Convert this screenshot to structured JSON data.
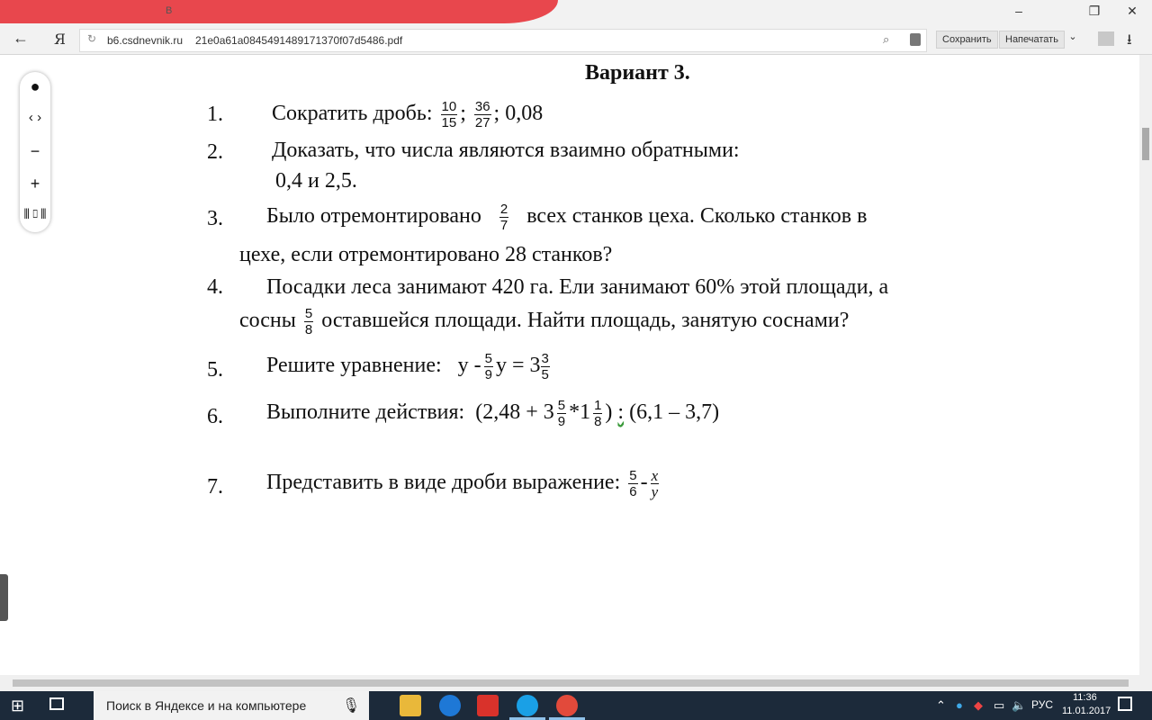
{
  "browser": {
    "tab_title": "В",
    "url_domain": "b6.csdnevnik.ru",
    "url_path": "21e0a61a0845491489171370f07d5486.pdf",
    "save_label": "Сохранить",
    "print_label": "Напечатать",
    "logo": "Я",
    "icons": [
      "back-icon",
      "reload-icon",
      "find-icon",
      "lock-icon",
      "download-icon",
      "minimize-icon",
      "maximize-icon",
      "close-icon"
    ]
  },
  "pdf_toolbar": {
    "items": [
      "dot-icon",
      "prev-next-icon",
      "zoom-out-icon",
      "zoom-in-icon",
      "fit-icon"
    ]
  },
  "document": {
    "heading": "Вариант 3.",
    "task1": {
      "num": "1.",
      "text": "Сократить  дробь:",
      "f1n": "10",
      "f1d": "15",
      "sep1": ";",
      "f2n": "36",
      "f2d": "27",
      "sep2": ";",
      "tail": "0,08"
    },
    "task2": {
      "num": "2.",
      "text": "Доказать,  что  числа  являются  взаимно  обратными:",
      "line2": "0,4  и  2,5."
    },
    "task3": {
      "num": "3.",
      "text_a": "Было  отремонтировано",
      "fn": "2",
      "fd": "7",
      "text_b": "всех  станков  цеха.  Сколько  станков  в",
      "line2": "цехе,  если  отремонтировано  28  станков?"
    },
    "task4": {
      "num": "4.",
      "text": "Посадки  леса  занимают  420 га.  Ели  занимают  60%  этой  площади,  а",
      "line2_a": "сосны",
      "fn": "5",
      "fd": "8",
      "line2_b": "оставшейся  площади.  Найти  площадь,  занятую  соснами?"
    },
    "task5": {
      "num": "5.",
      "text": "Решите  уравнение:",
      "eq_a": "у -",
      "fn": "5",
      "fd": "9",
      "eq_b": "у = 3",
      "mn": "3",
      "md": "5"
    },
    "task6": {
      "num": "6.",
      "text": "Выполните  действия:",
      "expr_a": "(2,48 + 3",
      "f1n": "5",
      "f1d": "9",
      "expr_b": "*1",
      "f2n": "1",
      "f2d": "8",
      "expr_c": ")",
      "expr_colon": ":",
      "expr_d": "(6,1 – 3,7)"
    },
    "task7": {
      "num": "7.",
      "text": "Представить  в  виде  дроби  выражение:",
      "f1n": "5",
      "f1d": "6",
      "minus": "-",
      "f2n": "x",
      "f2d": "y"
    }
  },
  "taskbar": {
    "search_placeholder": "Поиск в Яндексе и на компьютере",
    "lang": "РУС",
    "time": "11:36",
    "date": "11.01.2017",
    "apps": [
      "file-explorer-icon",
      "edge-icon",
      "yandex-icon",
      "skype-icon",
      "yandex-browser-icon"
    ]
  }
}
